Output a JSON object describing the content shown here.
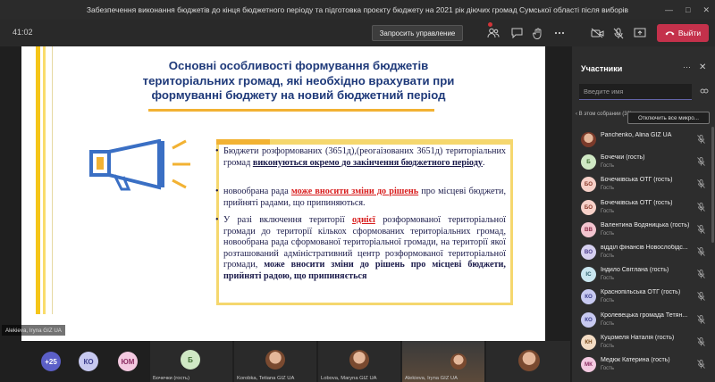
{
  "window": {
    "title": "Забезпечення виконання бюджетів до кінця бюджетного періоду та підготовка проєкту бюджету на 2021 рік діючих громад Сумської області після виборів",
    "controls": [
      "—",
      "□",
      "✕"
    ]
  },
  "toolbar": {
    "timer": "41:02",
    "request_control_label": "Запросить управление",
    "leave_label": "Выйти",
    "icons": [
      "participants-icon",
      "chat-icon",
      "raise-hand-icon",
      "more-icon",
      "camera-off-icon",
      "mic-off-icon",
      "share-icon"
    ]
  },
  "slide": {
    "title_lines": [
      "Основні особливості формування бюджетів",
      "територіальних громад, які необхідно врахувати при",
      "формуванні бюджету на новий бюджетний період"
    ],
    "bullets": [
      {
        "parts": [
          {
            "t": "Бюджети розформованих (3651д),(реогаізованих 3651д) територіальних громад ",
            "s": "n"
          },
          {
            "t": "виконуються окремо до закінчення бюджетного періоду",
            "s": "u"
          },
          {
            "t": ".",
            "s": "n"
          }
        ]
      },
      {
        "parts": [
          {
            "t": "новообрана рада ",
            "s": "n"
          },
          {
            "t": "може вносити зміни до рішень",
            "s": "red"
          },
          {
            "t": " про місцеві бюджети, прийняті радами, що припиняються.",
            "s": "n"
          }
        ]
      },
      {
        "parts": [
          {
            "t": "У разі включення території ",
            "s": "n"
          },
          {
            "t": "однієї",
            "s": "red"
          },
          {
            "t": " розформованої територіальної громади до території кількох сформованих територіальних громад, новообрана рада сформованої територіальної громади, на території якої розташований адміністративний центр розформованої територіальної громади, ",
            "s": "n"
          },
          {
            "t": "може вносити зміни до рішень про місцеві бюджети, прийняті радою, що припиняється",
            "s": "b"
          }
        ]
      }
    ],
    "presenter_label": "Alekieva, Iryna GIZ UA"
  },
  "gallery": {
    "overflow_count": "+25",
    "avatars": [
      {
        "initials": "КО",
        "bg": "#c7c9f0",
        "fg": "#3b3d8c"
      },
      {
        "initials": "ЮМ",
        "bg": "#f3c9e0",
        "fg": "#8c2f63"
      }
    ],
    "tiles": [
      {
        "name": "Бочечки (гость)",
        "initials": "Б",
        "bg": "#cfe8c4",
        "fg": "#3d6b2f"
      },
      {
        "name": "Korobka, Tetiana GIZ UA"
      },
      {
        "name": "Lobova, Maryna GIZ UA"
      },
      {
        "name": "Alekieva, Iryna GIZ UA"
      },
      {
        "name": ""
      }
    ]
  },
  "participants": {
    "title": "Участники",
    "search_placeholder": "Введите имя",
    "section_label": "В этом собрании (32)",
    "mute_all_label": "Отключить все микро...",
    "list": [
      {
        "name": "Panchenko, Alina GIZ UA",
        "role": "",
        "initials": "",
        "bg": "#8a5a4a",
        "fg": "#fff",
        "photo": true
      },
      {
        "name": "Бочечки (гость)",
        "role": "Гость",
        "initials": "Б",
        "bg": "#cfe8c4",
        "fg": "#3d6b2f"
      },
      {
        "name": "Бочечківська ОТГ (гость)",
        "role": "Гость",
        "initials": "БО",
        "bg": "#f6d0c8",
        "fg": "#8a3a2a"
      },
      {
        "name": "Бочечківська ОТГ (гость)",
        "role": "Гость",
        "initials": "БО",
        "bg": "#f6d0c8",
        "fg": "#8a3a2a"
      },
      {
        "name": "Валентина Водяницька (гость)",
        "role": "Гость",
        "initials": "ВВ",
        "bg": "#f2c4cf",
        "fg": "#8c2f4a"
      },
      {
        "name": "відділ фінансів Новослобідс...",
        "role": "Гость",
        "initials": "ВО",
        "bg": "#d6d0f0",
        "fg": "#4a3a8c"
      },
      {
        "name": "Індило Світлана (гость)",
        "role": "Гость",
        "initials": "ІС",
        "bg": "#c9e6ef",
        "fg": "#2a5d6b"
      },
      {
        "name": "Краснопільська ОТГ (гость)",
        "role": "Гость",
        "initials": "КО",
        "bg": "#c7c9f0",
        "fg": "#3b3d8c"
      },
      {
        "name": "Кролевецька громада Тетян...",
        "role": "Гость",
        "initials": "КО",
        "bg": "#c7c9f0",
        "fg": "#3b3d8c"
      },
      {
        "name": "Куцомеля Наталія (гость)",
        "role": "Гость",
        "initials": "КН",
        "bg": "#f3dcc4",
        "fg": "#7a4a1a"
      },
      {
        "name": "Медюк Катерина (гость)",
        "role": "Гость",
        "initials": "МК",
        "bg": "#f3c9e0",
        "fg": "#8c2f63"
      }
    ]
  }
}
